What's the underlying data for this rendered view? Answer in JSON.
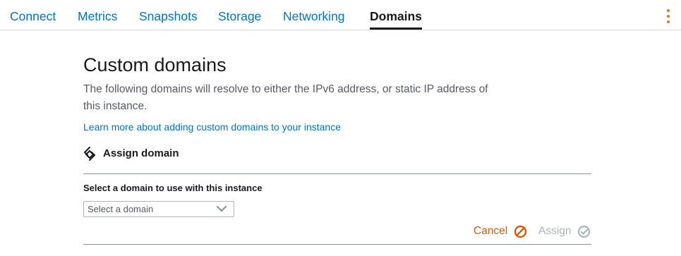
{
  "tabs": [
    {
      "label": "Connect"
    },
    {
      "label": "Metrics"
    },
    {
      "label": "Snapshots"
    },
    {
      "label": "Storage"
    },
    {
      "label": "Networking"
    },
    {
      "label": "Domains"
    }
  ],
  "active_tab": "Domains",
  "menu_icon": "vertical-ellipsis-icon",
  "page": {
    "title": "Custom domains",
    "description": "The following domains will resolve to either the IPv6 address, or static IP address of this instance.",
    "learn_more_link": "Learn more about adding custom domains to your instance"
  },
  "assign_section": {
    "icon": "domain-assign-icon",
    "heading": "Assign domain",
    "field_label": "Select a domain to use with this instance",
    "select_placeholder": "Select a domain",
    "cancel_label": "Cancel",
    "assign_label": "Assign"
  },
  "colors": {
    "link": "#0073bb",
    "accent_orange": "#ec7211",
    "cancel": "#d45b07",
    "disabled": "#aab7b8"
  }
}
